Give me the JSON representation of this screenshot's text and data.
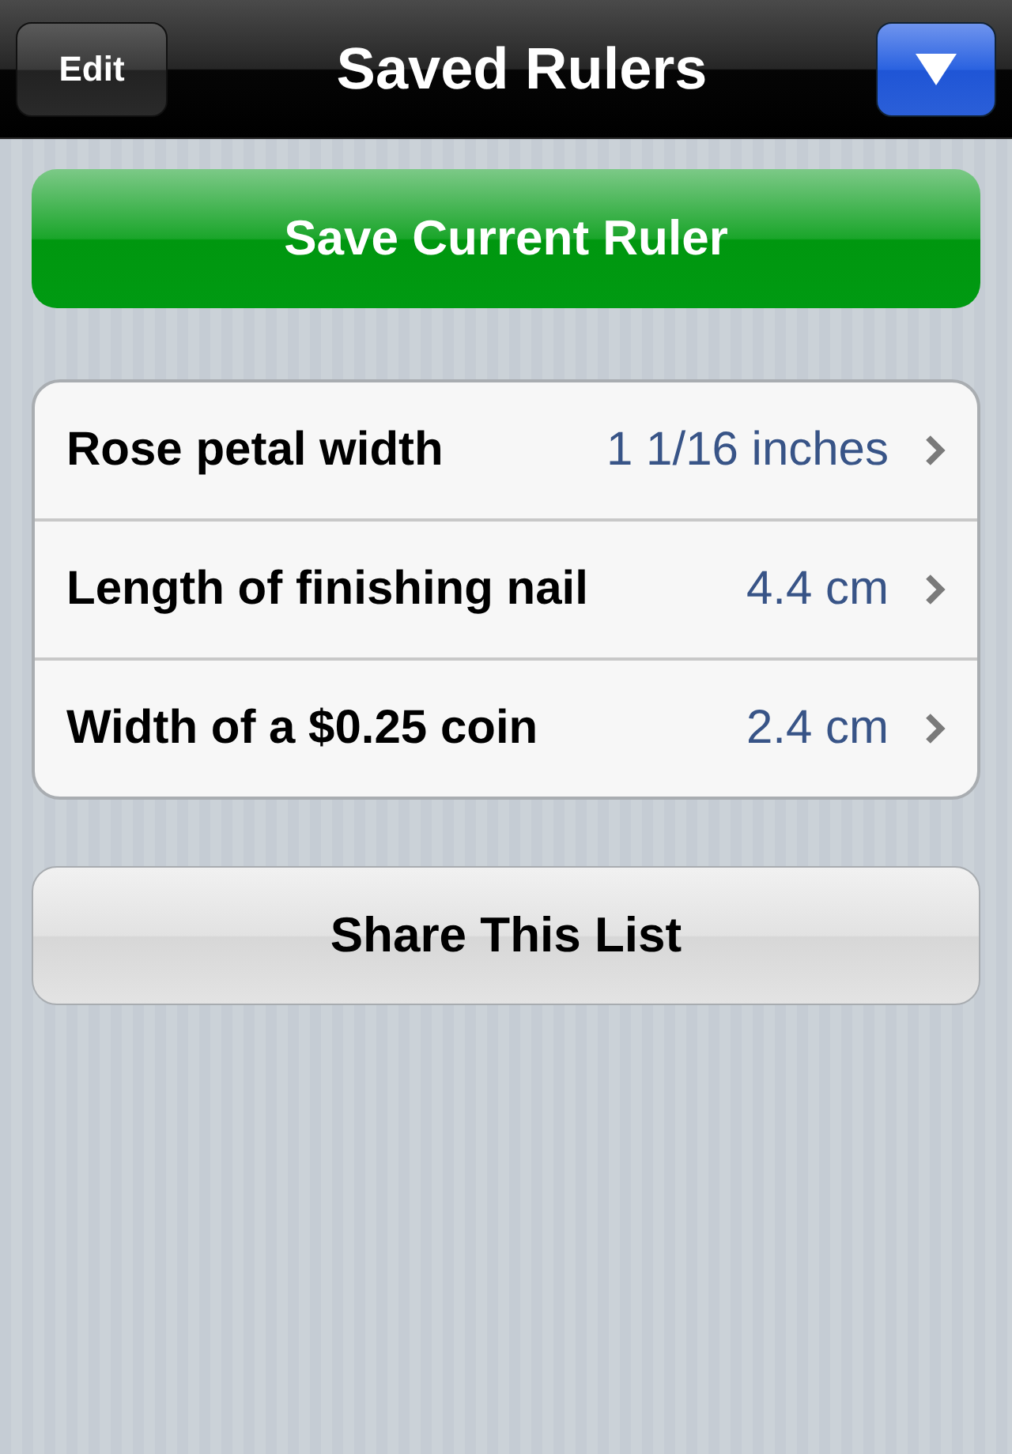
{
  "nav_bar": {
    "title": "Saved Rulers",
    "left_button": "Edit"
  },
  "save_button": "Save Current Ruler",
  "rulers": [
    {
      "name": "Rose petal width",
      "value": "1 1/16 inches"
    },
    {
      "name": "Length of finishing nail",
      "value": "4.4 cm"
    },
    {
      "name": "Width of a $0.25 coin",
      "value": "2.4 cm"
    }
  ],
  "share_button": "Share This List"
}
